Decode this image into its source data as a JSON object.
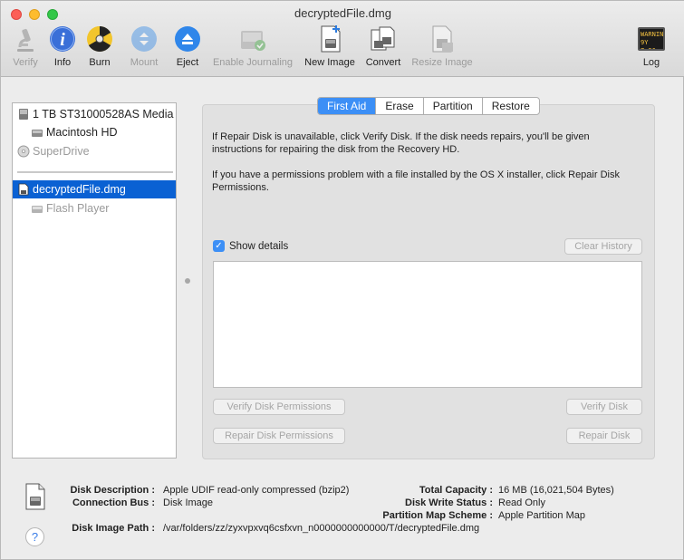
{
  "window": {
    "title": "decryptedFile.dmg"
  },
  "toolbar": {
    "items": [
      {
        "label": "Verify",
        "icon": "microscope-icon",
        "enabled": false
      },
      {
        "label": "Info",
        "icon": "info-icon",
        "enabled": true
      },
      {
        "label": "Burn",
        "icon": "burn-icon",
        "enabled": true
      },
      {
        "label": "Mount",
        "icon": "mount-icon",
        "enabled": false
      },
      {
        "label": "Eject",
        "icon": "eject-icon",
        "enabled": true
      },
      {
        "label": "Enable Journaling",
        "icon": "journaling-icon",
        "enabled": false
      },
      {
        "label": "New Image",
        "icon": "new-image-icon",
        "enabled": true
      },
      {
        "label": "Convert",
        "icon": "convert-icon",
        "enabled": true
      },
      {
        "label": "Resize Image",
        "icon": "resize-image-icon",
        "enabled": false
      }
    ],
    "log": {
      "label": "Log",
      "icon_text_line1": "WARNIN",
      "icon_text_line2": "9Y 7:36"
    }
  },
  "sidebar": {
    "items": [
      {
        "label": "1 TB ST31000528AS Media",
        "icon": "hard-disk-icon",
        "state": "normal"
      },
      {
        "label": "Macintosh HD",
        "icon": "volume-icon",
        "state": "normal"
      },
      {
        "label": "SuperDrive",
        "icon": "optical-drive-icon",
        "state": "dim"
      },
      {
        "label": "decryptedFile.dmg",
        "icon": "disk-image-icon",
        "state": "selected"
      },
      {
        "label": "Flash Player",
        "icon": "volume-icon",
        "state": "dim"
      }
    ]
  },
  "tabs": [
    {
      "label": "First Aid",
      "active": true
    },
    {
      "label": "Erase",
      "active": false
    },
    {
      "label": "Partition",
      "active": false
    },
    {
      "label": "Restore",
      "active": false
    }
  ],
  "first_aid": {
    "para1": "If Repair Disk is unavailable, click Verify Disk. If the disk needs repairs, you'll be given instructions for repairing the disk from the Recovery HD.",
    "para2": "If you have a permissions problem with a file installed by the OS X installer, click Repair Disk Permissions.",
    "show_details_label": "Show details",
    "show_details_checked": true,
    "clear_history_label": "Clear History",
    "verify_permissions_label": "Verify Disk Permissions",
    "repair_permissions_label": "Repair Disk Permissions",
    "verify_disk_label": "Verify Disk",
    "repair_disk_label": "Repair Disk"
  },
  "info": {
    "disk_description_key": "Disk Description :",
    "disk_description_val": "Apple UDIF read-only compressed (bzip2)",
    "connection_bus_key": "Connection Bus :",
    "connection_bus_val": "Disk Image",
    "disk_image_path_key": "Disk Image Path :",
    "disk_image_path_val": "/var/folders/zz/zyxvpxvq6csfxvn_n0000000000000/T/decryptedFile.dmg",
    "total_capacity_key": "Total Capacity :",
    "total_capacity_val": "16 MB (16,021,504 Bytes)",
    "disk_write_status_key": "Disk Write Status :",
    "disk_write_status_val": "Read Only",
    "partition_map_key": "Partition Map Scheme :",
    "partition_map_val": "Apple Partition Map",
    "help_label": "?"
  },
  "colors": {
    "selection": "#0a61d3",
    "tab_active": "#3c8ff6",
    "info_blue": "#3a6fd8"
  }
}
